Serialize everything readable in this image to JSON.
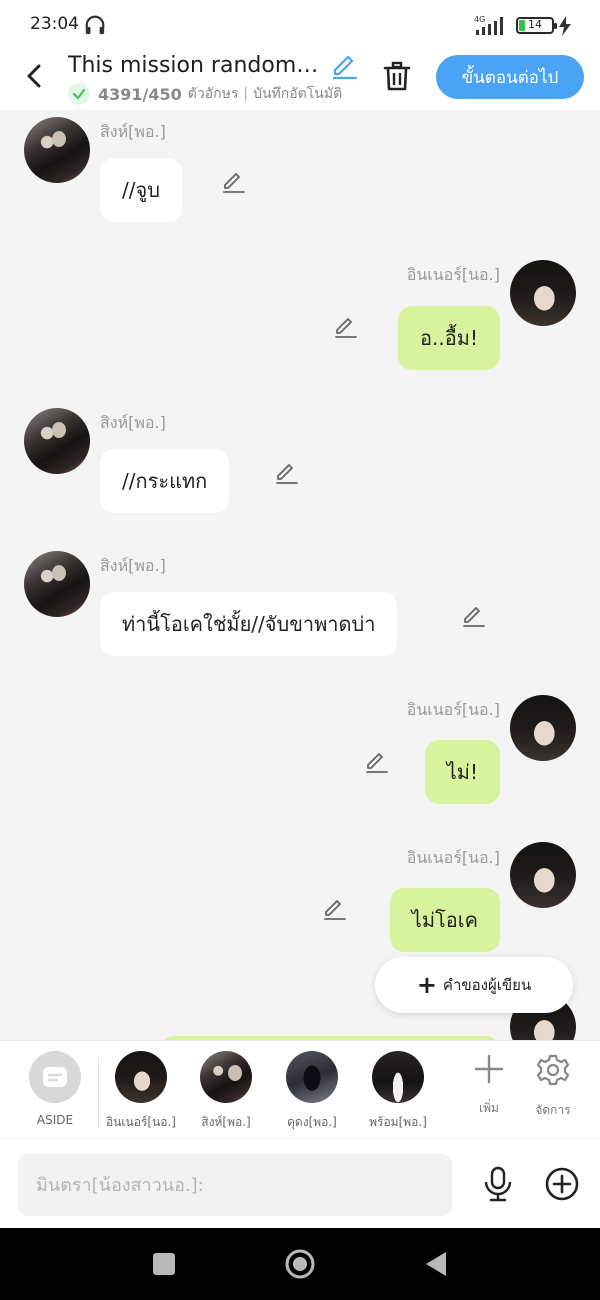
{
  "status_bar": {
    "time": "23:04",
    "network": "4G",
    "battery": "14"
  },
  "header": {
    "title": "This mission randomly...",
    "char_count": "4391/450",
    "char_label": "ตัวอักษร",
    "separator": "|",
    "autosave": "บันทึกอัตโนมัติ",
    "next_label": "ขั้นตอนต่อไป"
  },
  "messages": [
    {
      "sender": "สิงห์[พอ.]",
      "text": "//จูบ",
      "side": "left"
    },
    {
      "sender": "อินเนอร์[นอ.]",
      "text": "อ..อื้ม!",
      "side": "right"
    },
    {
      "sender": "สิงห์[พอ.]",
      "text": "//กระแทก",
      "side": "left"
    },
    {
      "sender": "สิงห์[พอ.]",
      "text": "ท่านี้โอเคใช่มั้ย//จับขาพาดบ่า",
      "side": "left"
    },
    {
      "sender": "อินเนอร์[นอ.]",
      "text": "ไม่!",
      "side": "right"
    },
    {
      "sender": "อินเนอร์[นอ.]",
      "text": "ไม่โอเค",
      "side": "right"
    }
  ],
  "writer_button": "คำของผู้เขียน",
  "characters": [
    {
      "name": "ASIDE"
    },
    {
      "name": "อินเนอร์[นอ.]"
    },
    {
      "name": "สิงห์[พอ.]"
    },
    {
      "name": "ดุดง[พอ.]"
    },
    {
      "name": "พร้อม[พอ.]"
    }
  ],
  "tools": {
    "add": "เพิ่ม",
    "manage": "จัดการ"
  },
  "input": {
    "placeholder": "มินตรา[น้องสาวนอ.]:"
  },
  "colors": {
    "accent": "#4ba3f5",
    "right_bubble": "#d8f39e",
    "left_bubble": "#ffffff",
    "check": "#4cc25f"
  }
}
